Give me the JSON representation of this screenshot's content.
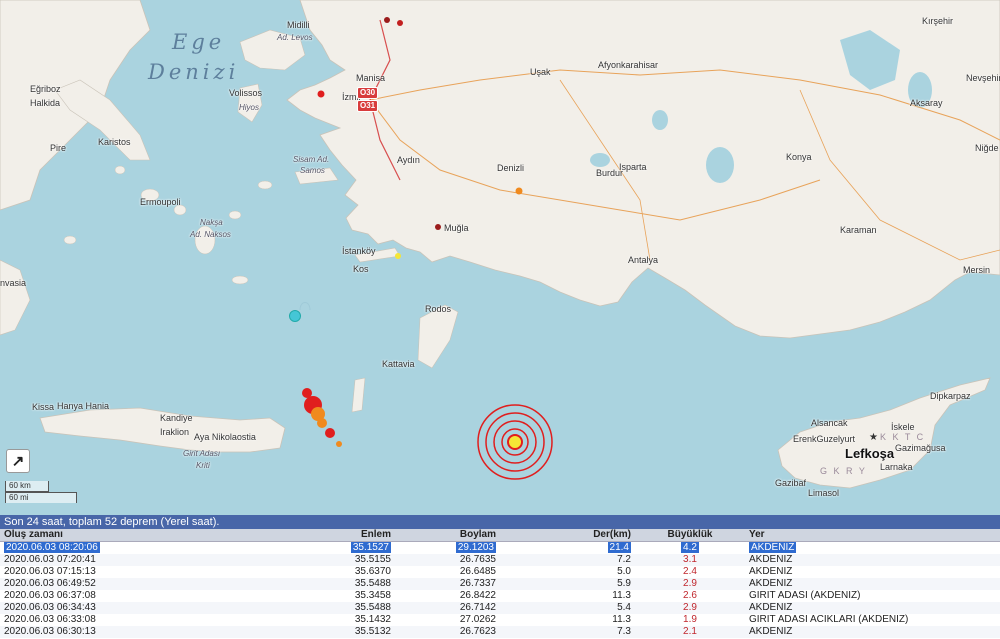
{
  "map": {
    "sea_label_line1": "Ege",
    "sea_label_line2": "Denizi",
    "labels": [
      {
        "id": "midilli",
        "text": "Midilli"
      },
      {
        "id": "levos",
        "text": "Ad. Levos"
      },
      {
        "id": "manisa",
        "text": "Manisa"
      },
      {
        "id": "izmir",
        "text": "İzmir"
      },
      {
        "id": "usak",
        "text": "Uşak"
      },
      {
        "id": "afyon",
        "text": "Afyonkarahisar"
      },
      {
        "id": "kirsehir",
        "text": "Kırşehir"
      },
      {
        "id": "nevsehir",
        "text": "Nevşehir"
      },
      {
        "id": "aksaray",
        "text": "Aksaray"
      },
      {
        "id": "nigde",
        "text": "Niğde"
      },
      {
        "id": "egriboz",
        "text": "Eğriboz"
      },
      {
        "id": "halkida",
        "text": "Halkida"
      },
      {
        "id": "volissos",
        "text": "Volissos"
      },
      {
        "id": "hiyos",
        "text": "Hiyos"
      },
      {
        "id": "pire",
        "text": "Pire"
      },
      {
        "id": "karistos",
        "text": "Karistos"
      },
      {
        "id": "aydin",
        "text": "Aydın"
      },
      {
        "id": "denizli",
        "text": "Denizli"
      },
      {
        "id": "isparta",
        "text": "Isparta"
      },
      {
        "id": "burdur",
        "text": "Burdur"
      },
      {
        "id": "konya",
        "text": "Konya"
      },
      {
        "id": "sisam",
        "text": "Sisam Ad."
      },
      {
        "id": "samos",
        "text": "Samos"
      },
      {
        "id": "ermoupoli",
        "text": "Ermoupoli"
      },
      {
        "id": "naksa",
        "text": "Nakşa"
      },
      {
        "id": "naksos",
        "text": "Ad. Naksos"
      },
      {
        "id": "mugla",
        "text": "Muğla"
      },
      {
        "id": "karaman",
        "text": "Karaman"
      },
      {
        "id": "istankoy",
        "text": "İstanköy"
      },
      {
        "id": "kos",
        "text": "Kos"
      },
      {
        "id": "antalya",
        "text": "Antalya"
      },
      {
        "id": "mersin",
        "text": "Mersin"
      },
      {
        "id": "monvasia",
        "text": "nvasia"
      },
      {
        "id": "rodos",
        "text": "Rodos"
      },
      {
        "id": "kattavia",
        "text": "Kattavia"
      },
      {
        "id": "kissa",
        "text": "Kissa"
      },
      {
        "id": "hanya",
        "text": "Hanya Hania"
      },
      {
        "id": "kandiye",
        "text": "Kandiye"
      },
      {
        "id": "iraklion",
        "text": "Iraklion"
      },
      {
        "id": "aya",
        "text": "Aya Nikolaostia"
      },
      {
        "id": "girit",
        "text": "Girit Adası"
      },
      {
        "id": "kriti",
        "text": "Kriti"
      },
      {
        "id": "dipkarpaz",
        "text": "Dipkarpaz"
      },
      {
        "id": "alsancak",
        "text": "Alsancak"
      },
      {
        "id": "iskele",
        "text": "İskele"
      },
      {
        "id": "erenk",
        "text": "ErenkGuzelyurt"
      },
      {
        "id": "gazimagusa",
        "text": "Gazimağusa"
      },
      {
        "id": "larnaka",
        "text": "Larnaka"
      },
      {
        "id": "gazibaf",
        "text": "Gazibaf"
      },
      {
        "id": "limasol",
        "text": "Limasol"
      },
      {
        "id": "lefkosa",
        "text": "Lefkoşa"
      },
      {
        "id": "kktc",
        "text": "K K T C"
      },
      {
        "id": "gkry",
        "text": "G K R Y"
      }
    ],
    "road_shields": [
      {
        "id": "o30",
        "text": "O30"
      },
      {
        "id": "o31",
        "text": "O31"
      }
    ],
    "colors": {
      "sea": "#aad3df",
      "land": "#f2efe9",
      "quake_red": "#e01e1e",
      "quake_orange": "#f08a1e",
      "quake_yellow": "#f5e636",
      "quake_cyan": "#45c6d6"
    }
  },
  "controls": {
    "expand_icon": "↗"
  },
  "scale": {
    "km": "60 km",
    "mi": "60 mi"
  },
  "panel": {
    "summary": "Son 24 saat, toplam 52 deprem (Yerel saat).",
    "columns": {
      "time": "Oluş zamanı",
      "lat": "Enlem",
      "lon": "Boylam",
      "depth": "Der(km)",
      "mag": "Büyüklük",
      "place": "Yer"
    },
    "rows": [
      {
        "time": "2020.06.03 08:20:06",
        "lat": "35.1527",
        "lon": "29.1203",
        "depth": "21.4",
        "mag": "4.2",
        "place": "AKDENIZ"
      },
      {
        "time": "2020.06.03 07:20:41",
        "lat": "35.5155",
        "lon": "26.7635",
        "depth": "7.2",
        "mag": "3.1",
        "place": "AKDENIZ"
      },
      {
        "time": "2020.06.03 07:15:13",
        "lat": "35.6370",
        "lon": "26.6485",
        "depth": "5.0",
        "mag": "2.4",
        "place": "AKDENIZ"
      },
      {
        "time": "2020.06.03 06:49:52",
        "lat": "35.5488",
        "lon": "26.7337",
        "depth": "5.9",
        "mag": "2.9",
        "place": "AKDENIZ"
      },
      {
        "time": "2020.06.03 06:37:08",
        "lat": "35.3458",
        "lon": "26.8422",
        "depth": "11.3",
        "mag": "2.6",
        "place": "GIRIT ADASI (AKDENIZ)"
      },
      {
        "time": "2020.06.03 06:34:43",
        "lat": "35.5488",
        "lon": "26.7142",
        "depth": "5.4",
        "mag": "2.9",
        "place": "AKDENIZ"
      },
      {
        "time": "2020.06.03 06:33:08",
        "lat": "35.1432",
        "lon": "27.0262",
        "depth": "11.3",
        "mag": "1.9",
        "place": "GIRIT ADASI ACIKLARI (AKDENIZ)"
      },
      {
        "time": "2020.06.03 06:30:13",
        "lat": "35.5132",
        "lon": "26.7623",
        "depth": "7.3",
        "mag": "2.1",
        "place": "AKDENIZ"
      }
    ]
  }
}
